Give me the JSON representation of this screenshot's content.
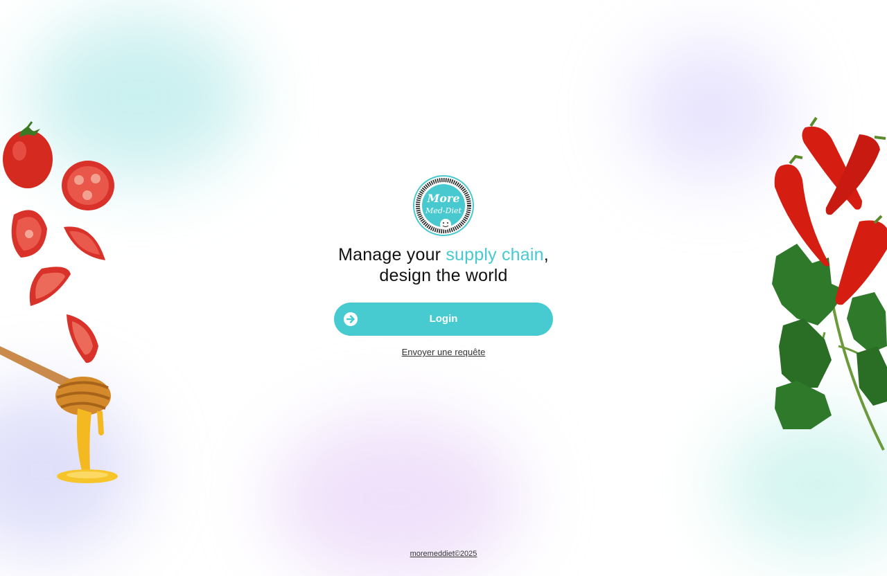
{
  "brand": {
    "logo_text_line1": "More",
    "logo_text_line2": "Med-Diet",
    "logo_ring_text": "MORE ON THE ADOPTION OF A HEALTHY MEDITERRANEAN DIET",
    "accent_color": "#47cbd0"
  },
  "hero": {
    "headline_prefix": "Manage your ",
    "headline_accent": "supply chain",
    "headline_suffix": ",",
    "headline_line2": "design the world"
  },
  "actions": {
    "login_label": "Login",
    "login_icon": "arrow-right-circle-icon",
    "request_link": "Envoyer une requête"
  },
  "footer": {
    "copyright": "moremeddiet©2025"
  }
}
